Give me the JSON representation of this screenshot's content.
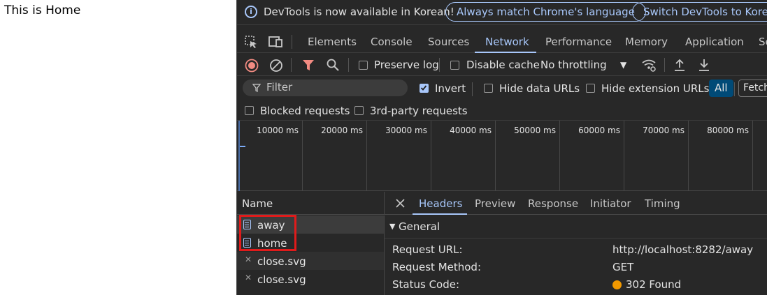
{
  "page": {
    "text": "This is Home"
  },
  "infobar": {
    "message": "DevTools is now available in Korean!",
    "match_button": "Always match Chrome's language",
    "switch_button": "Switch DevTools to Korean"
  },
  "tabs": [
    "Elements",
    "Console",
    "Sources",
    "Network",
    "Performance",
    "Memory",
    "Application",
    "Se"
  ],
  "active_tab": "Network",
  "toolbar": {
    "preserve_log": "Preserve log",
    "disable_cache": "Disable cache",
    "throttling": "No throttling"
  },
  "filterbar": {
    "filter_placeholder": "Filter",
    "invert": "Invert",
    "hide_data_urls": "Hide data URLs",
    "hide_extension_urls": "Hide extension URLs",
    "all": "All",
    "fetch": "Fetch/"
  },
  "blockedbar": {
    "blocked_requests": "Blocked requests",
    "third_party": "3rd-party requests"
  },
  "timeline_ticks": [
    "10000 ms",
    "20000 ms",
    "30000 ms",
    "40000 ms",
    "50000 ms",
    "60000 ms",
    "70000 ms",
    "80000 ms"
  ],
  "requests": {
    "header": "Name",
    "items": [
      {
        "name": "away",
        "icon": "document-icon"
      },
      {
        "name": "home",
        "icon": "document-icon"
      },
      {
        "name": "close.svg",
        "icon": "cross-icon"
      },
      {
        "name": "close.svg",
        "icon": "cross-icon"
      }
    ]
  },
  "detail": {
    "tabs": [
      "Headers",
      "Preview",
      "Response",
      "Initiator",
      "Timing"
    ],
    "active_tab": "Headers",
    "section": "General",
    "fields": [
      {
        "key": "Request URL:",
        "value": "http://localhost:8282/away"
      },
      {
        "key": "Request Method:",
        "value": "GET"
      },
      {
        "key": "Status Code:",
        "value": "302 Found"
      }
    ]
  },
  "colors": {
    "accent": "#a8c7fa",
    "record": "#f28b82",
    "status_dot": "#f29900",
    "highlight": "#e01b1b"
  }
}
